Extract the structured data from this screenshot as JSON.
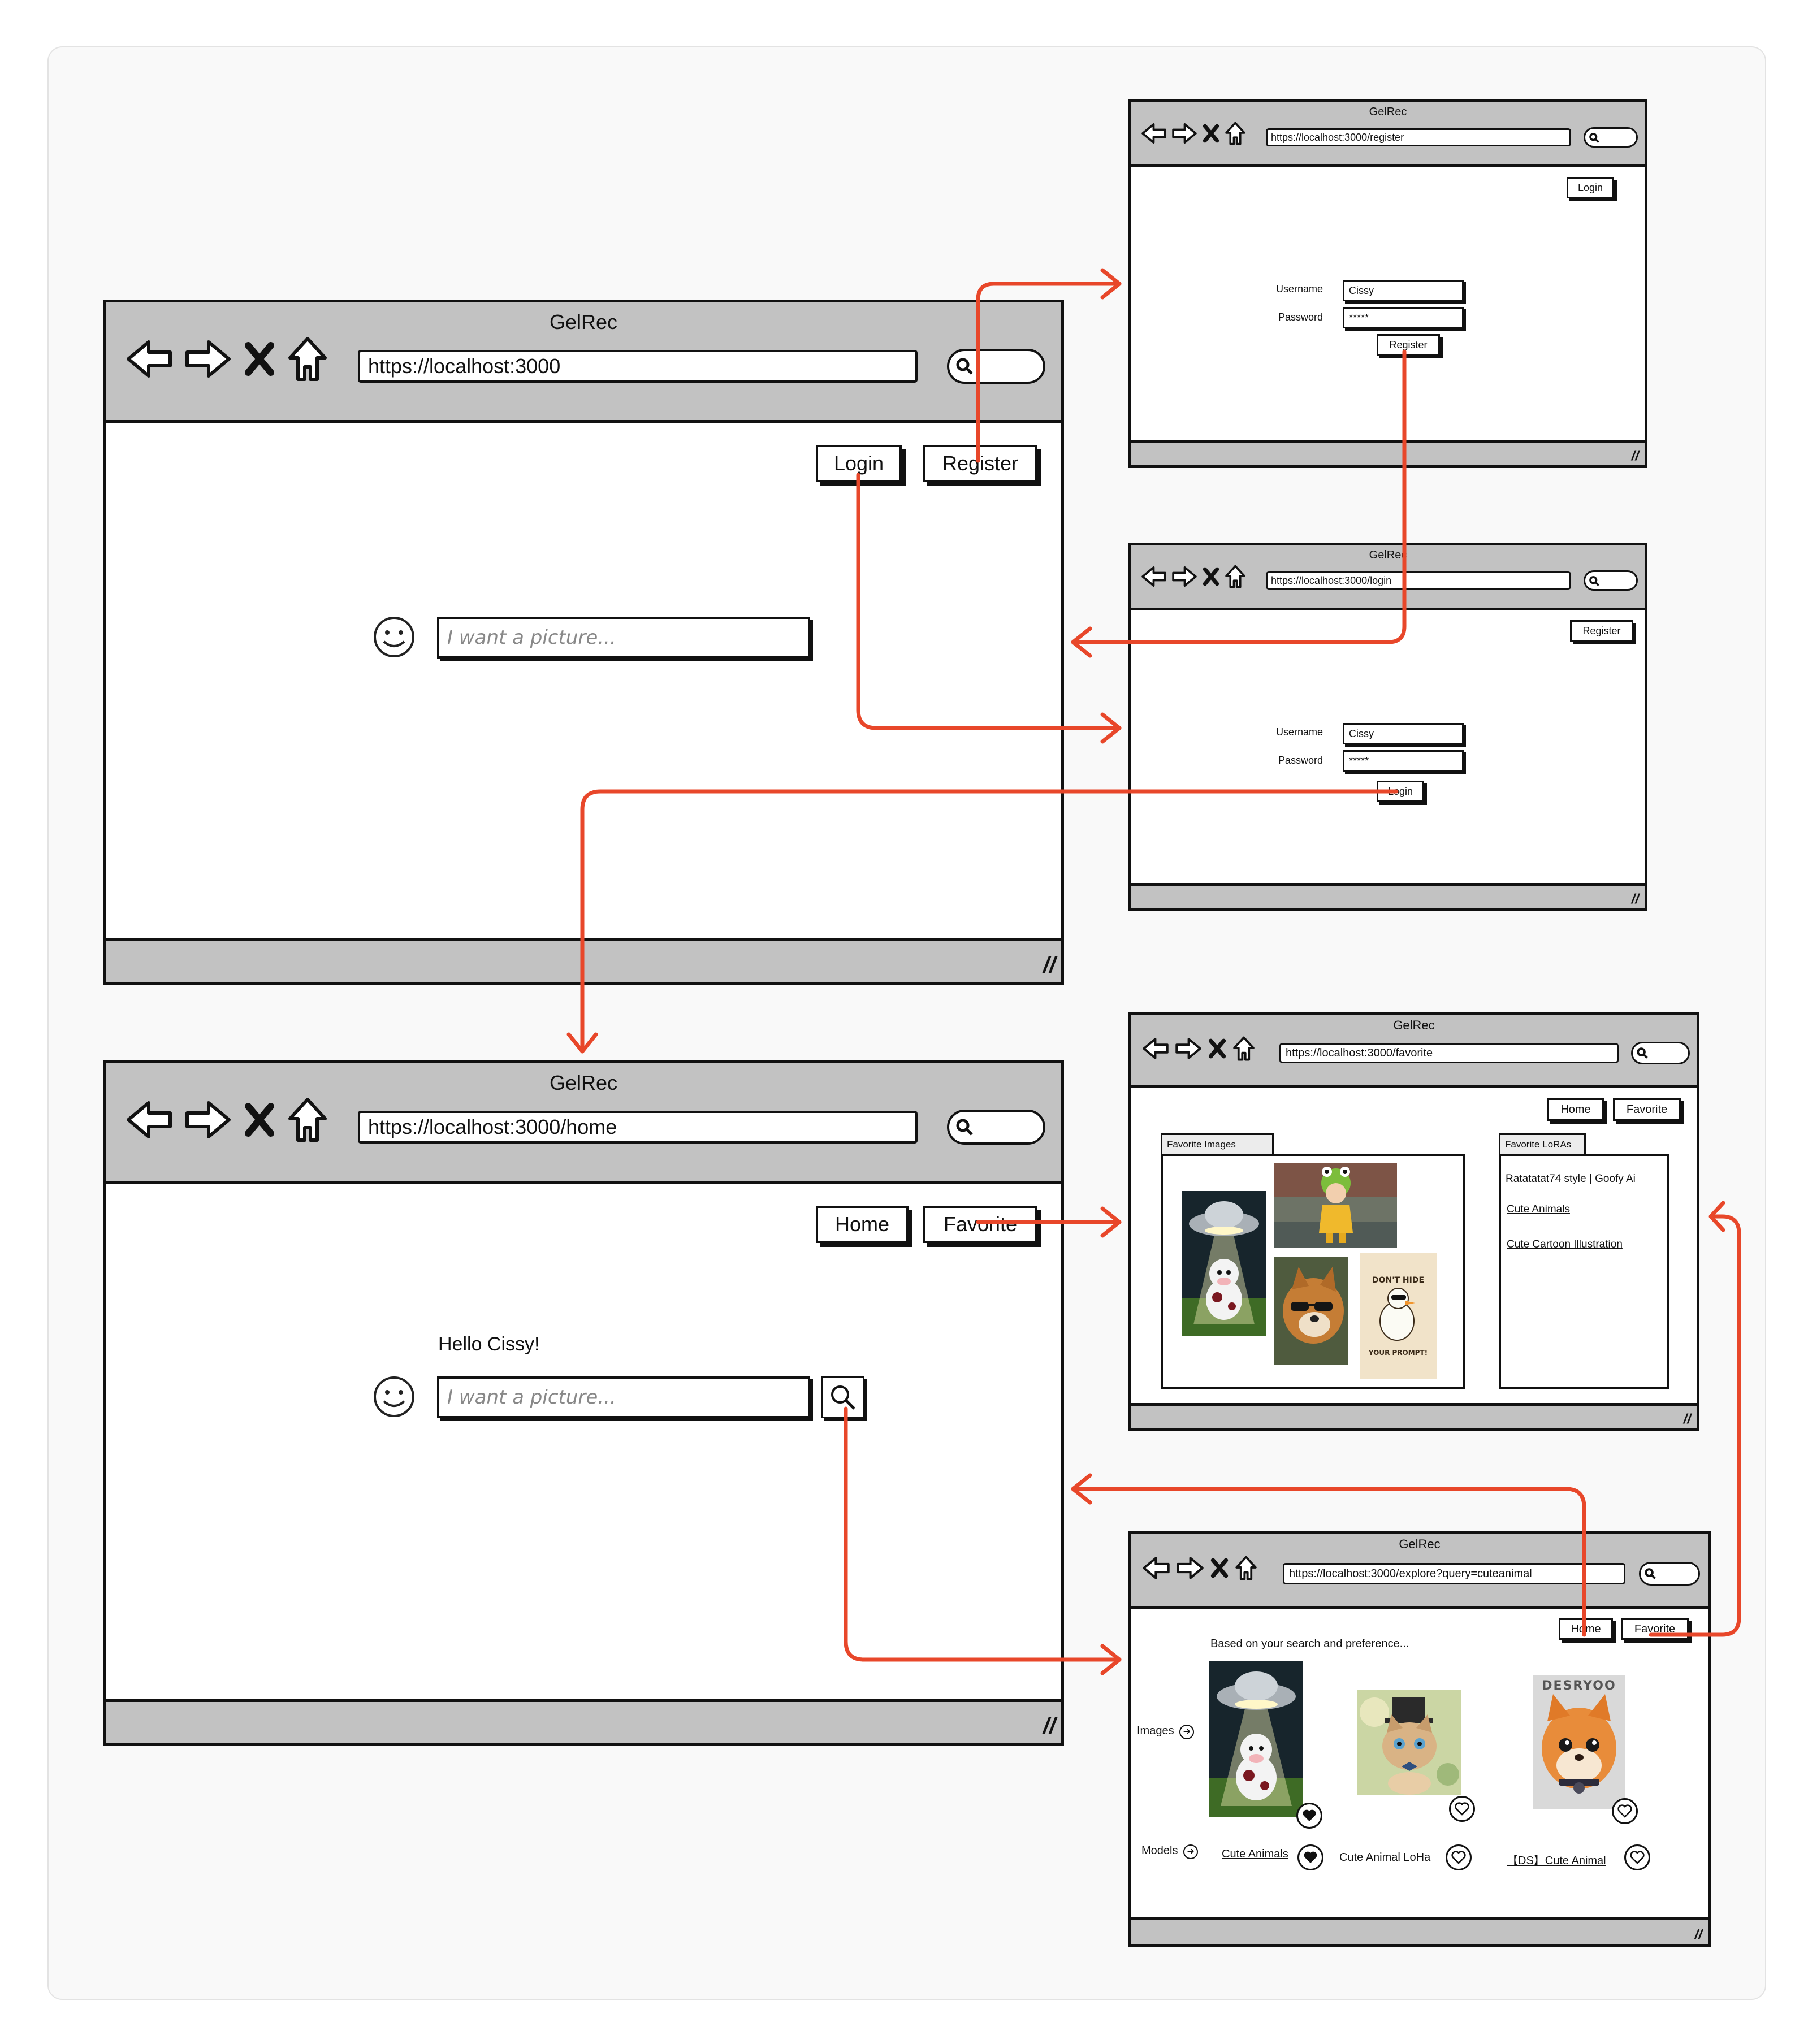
{
  "app_title": "GelRec",
  "windows": {
    "landing": {
      "url": "https://localhost:3000",
      "login_label": "Login",
      "register_label": "Register",
      "search_placeholder": "I want a picture..."
    },
    "register": {
      "url": "https://localhost:3000/register",
      "login_label": "Login",
      "username_label": "Username",
      "username_value": "Cissy",
      "password_label": "Password",
      "password_value": "*****",
      "submit_label": "Register"
    },
    "login": {
      "url": "https://localhost:3000/login",
      "register_label": "Register",
      "username_label": "Username",
      "username_value": "Cissy",
      "password_label": "Password",
      "password_value": "*****",
      "submit_label": "Login"
    },
    "home": {
      "url": "https://localhost:3000/home",
      "home_label": "Home",
      "favorite_label": "Favorite",
      "greeting": "Hello Cissy!",
      "search_placeholder": "I want a picture..."
    },
    "favorite": {
      "url": "https://localhost:3000/favorite",
      "home_label": "Home",
      "favorite_label": "Favorite",
      "images_tab": "Favorite Images",
      "loras_tab": "Favorite LoRAs",
      "loras": [
        "Ratatatat74 style | Goofy Ai",
        "Cute Animals",
        "Cute Cartoon Illustration"
      ],
      "sticker_text_1": "DON'T HIDE",
      "sticker_text_2": "YOUR PROMPT!"
    },
    "explore": {
      "url": "https://localhost:3000/explore?query=cuteanimal",
      "home_label": "Home",
      "favorite_label": "Favorite",
      "intro": "Based on your search and preference...",
      "images_label": "Images",
      "models_label": "Models",
      "models": [
        "Cute Animals",
        "Cute Animal LoHa",
        "【DS】Cute Animal"
      ],
      "brand_text": "DESRYOO"
    }
  },
  "colors": {
    "arrow": "#e8472a",
    "chrome": "#c2c2c2",
    "ink": "#111111"
  }
}
